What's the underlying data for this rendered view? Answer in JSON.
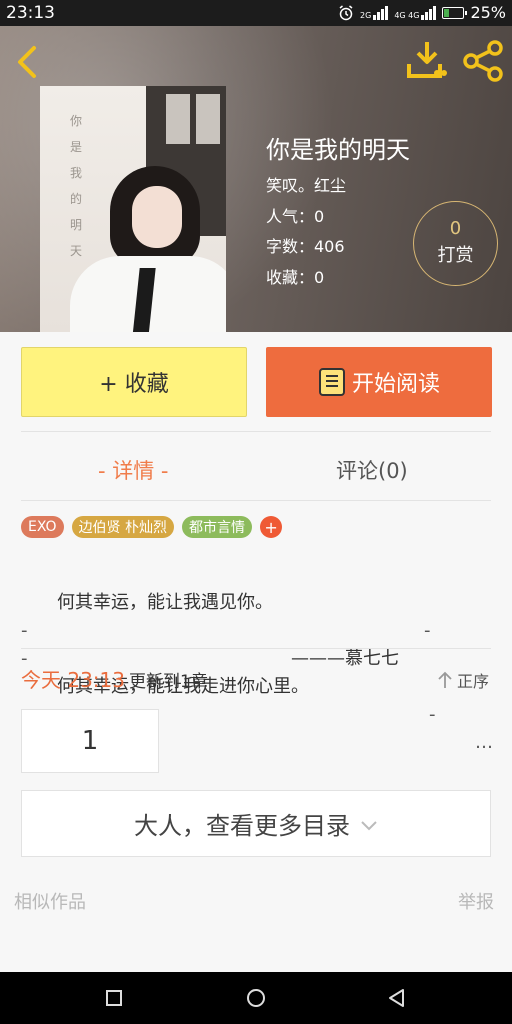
{
  "status": {
    "time": "23:13",
    "network1": "2G",
    "network2": "4G 4G",
    "battery_percent": "25%",
    "battery_level": 0.25
  },
  "book": {
    "title": "你是我的明天",
    "author": "笑叹。红尘",
    "popularity": "人气：0",
    "word_count": "字数：406",
    "favorites": "收藏：0",
    "reward_count": "0",
    "reward_label": "打赏",
    "cover_text": "你是我的明天"
  },
  "actions": {
    "favorite_label": "+ 收藏",
    "read_label": "开始阅读"
  },
  "tabs": {
    "detail": "- 详情 -",
    "comments": "评论(0)"
  },
  "tags": [
    "EXO",
    "边伯贤 朴灿烈",
    "都市言情"
  ],
  "tag_add": "+",
  "description": {
    "line1": "何其幸运，能让我遇见你。",
    "line2": "———慕七七",
    "line3": "何其幸运，能让我走进你心里。",
    "ellipsis": "…",
    "dash": "-"
  },
  "update": {
    "time": "今天 23:13",
    "text": "更新到1章",
    "order": "正序"
  },
  "chapter_number": "1",
  "more_toc": "大人，查看更多目录",
  "footer": {
    "similar": "相似作品",
    "report": "举报"
  },
  "colors": {
    "accent": "#ee6c3e",
    "favorite_bg": "#fff37e",
    "reward_ring": "#d7b673"
  }
}
